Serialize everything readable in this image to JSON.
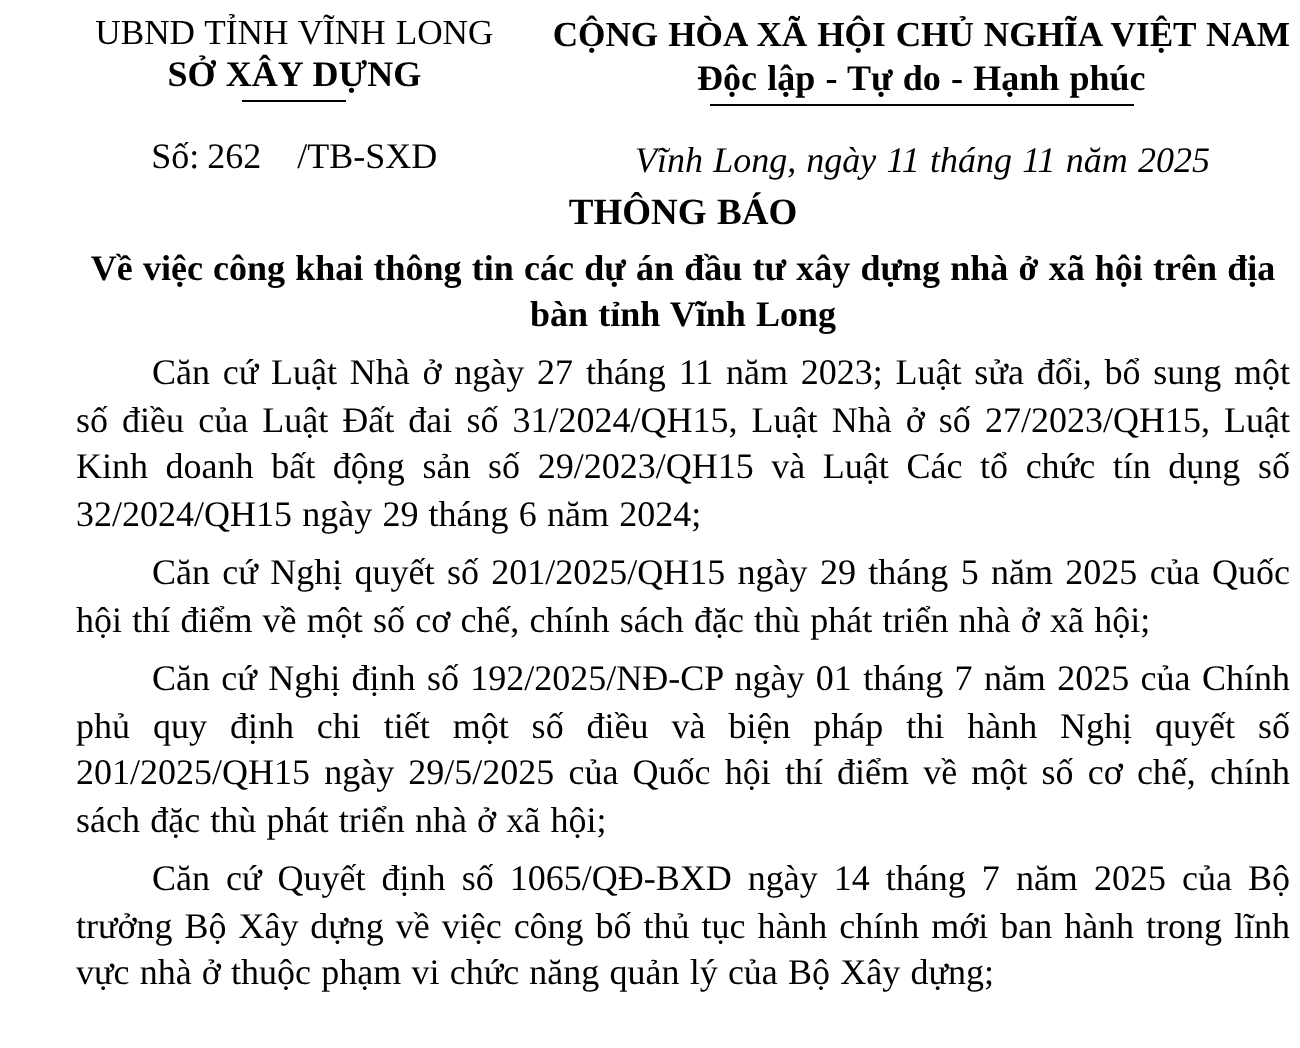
{
  "header": {
    "left": {
      "agency": "UBND TỈNH VĨNH LONG",
      "department": "SỞ XÂY DỰNG",
      "number_label": "Số:",
      "number": "262",
      "number_suffix": "/TB-SXD"
    },
    "right": {
      "nation": "CỘNG HÒA XÃ HỘI CHỦ NGHĨA VIỆT NAM",
      "motto": "Độc lập - Tự do - Hạnh phúc",
      "date_line": "Vĩnh Long, ngày 11 tháng 11 năm 2025"
    }
  },
  "title": "THÔNG BÁO",
  "subtitle": "Về việc công khai thông tin các dự án đầu tư xây dựng nhà ở xã hội trên địa bàn tỉnh Vĩnh Long",
  "paragraphs": [
    "Căn cứ Luật Nhà ở ngày 27 tháng 11 năm 2023; Luật sửa đổi, bổ sung một số điều của Luật Đất đai số 31/2024/QH15, Luật Nhà ở số 27/2023/QH15, Luật Kinh doanh bất động sản số 29/2023/QH15 và Luật Các tổ chức tín dụng số 32/2024/QH15 ngày 29 tháng 6 năm 2024;",
    "Căn cứ Nghị quyết số 201/2025/QH15 ngày 29 tháng 5 năm 2025 của Quốc hội thí điểm về một số cơ chế, chính sách đặc thù phát triển nhà ở xã hội;",
    "Căn cứ Nghị định số 192/2025/NĐ-CP ngày 01 tháng 7 năm 2025 của Chính phủ quy định chi tiết một số điều và biện pháp thi hành Nghị quyết số 201/2025/QH15 ngày 29/5/2025 của Quốc hội thí điểm về một số cơ chế, chính sách đặc thù phát triển nhà ở xã hội;",
    "Căn cứ Quyết định số 1065/QĐ-BXD ngày 14 tháng 7 năm 2025 của Bộ trưởng Bộ Xây dựng về việc công bố thủ tục hành chính mới ban hành trong lĩnh vực nhà ở thuộc phạm vi chức năng quản lý của Bộ Xây dựng;"
  ]
}
